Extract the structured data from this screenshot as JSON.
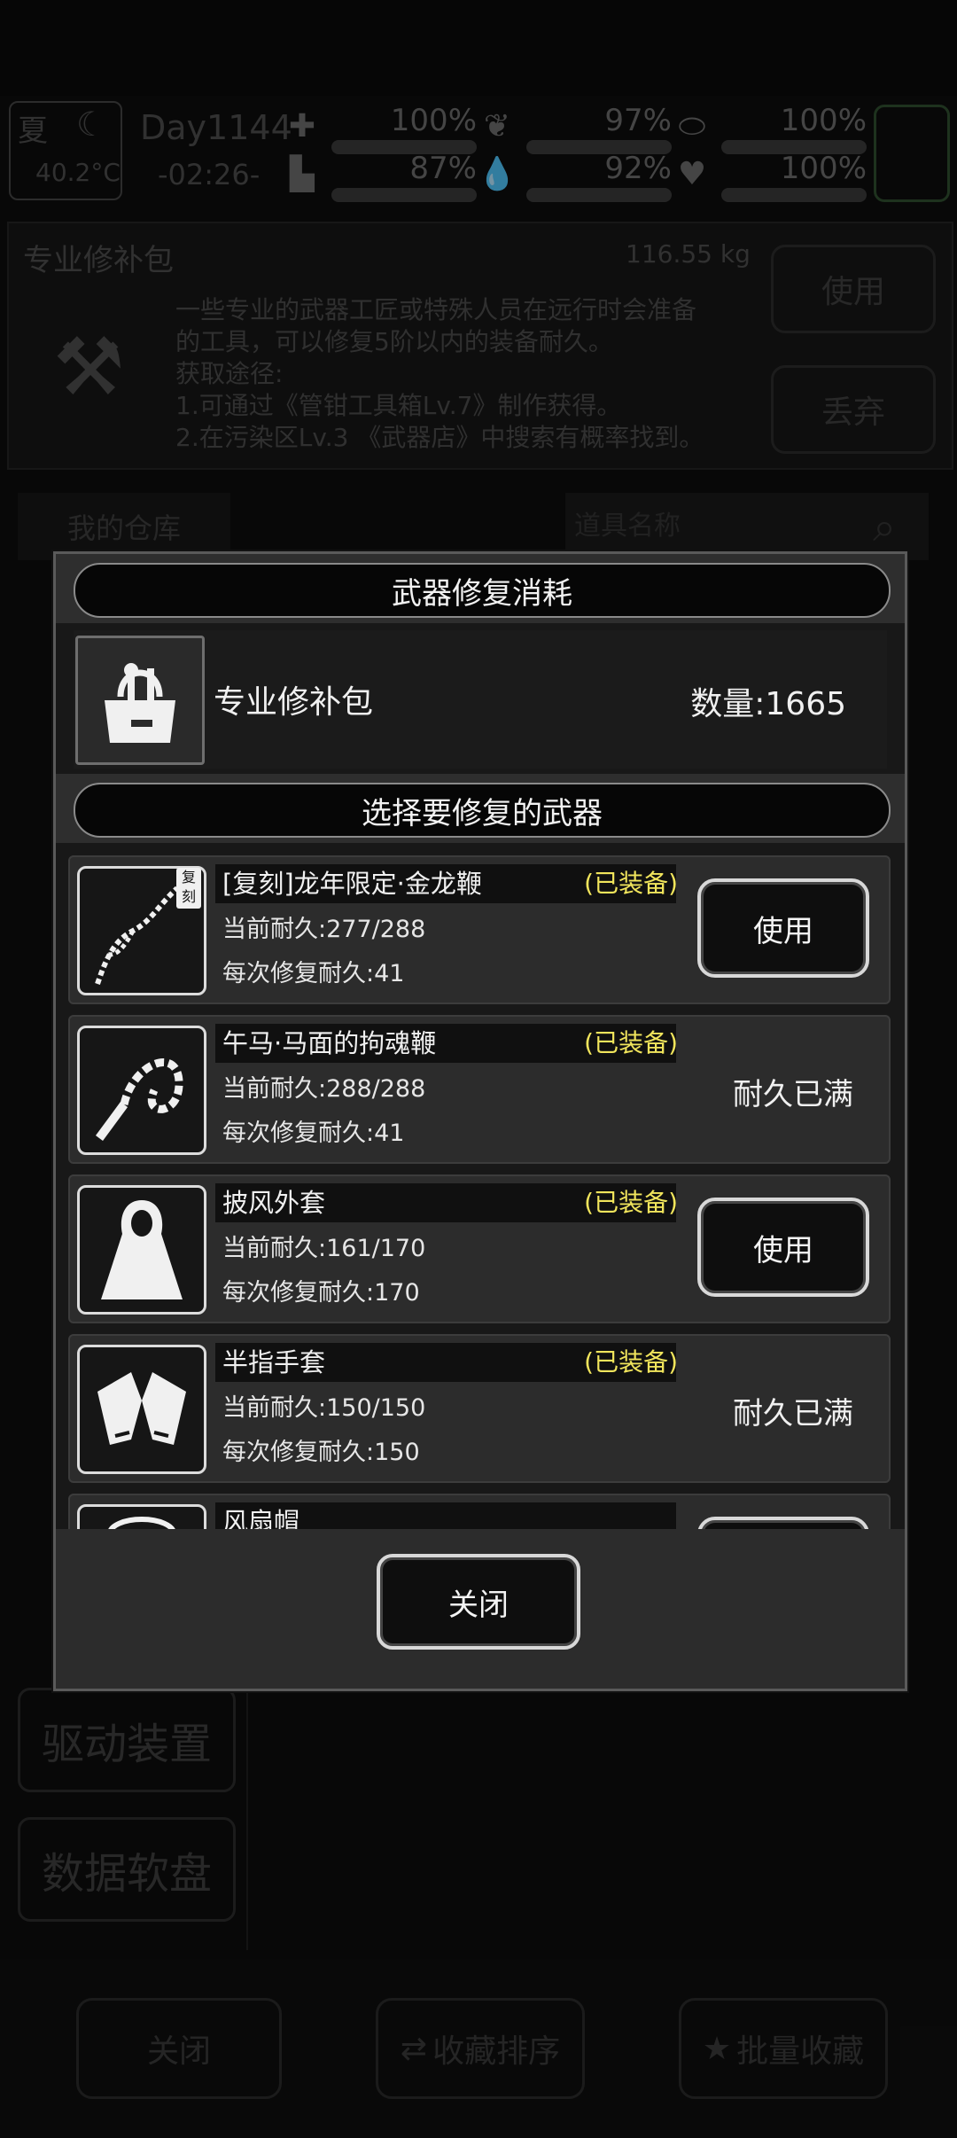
{
  "hud": {
    "season": "夏",
    "temperature": "40.2°C",
    "day": "Day1144",
    "time": "-02:26-",
    "stats": [
      {
        "icon": "medkit-icon",
        "value": "100%",
        "level": 1.0
      },
      {
        "icon": "stomach-icon",
        "value": "97%",
        "level": 0.97
      },
      {
        "icon": "pill-icon",
        "value": "100%",
        "level": 1.0
      },
      {
        "icon": "boot-icon",
        "value": "87%",
        "level": 0.87
      },
      {
        "icon": "water-drop-icon",
        "value": "92%",
        "level": 0.92
      },
      {
        "icon": "heart-icon",
        "value": "100%",
        "level": 1.0
      }
    ]
  },
  "item_panel": {
    "name": "专业修补包",
    "weight": "116.55 kg",
    "description": [
      "一些专业的武器工匠或特殊人员在远行时会准备",
      "的工具，可以修复5阶以内的装备耐久。",
      "获取途径:",
      "1.可通过《管钳工具箱Lv.7》制作获得。",
      "2.在污染区Lv.3 《武器店》中搜索有概率找到。"
    ],
    "use_label": "使用",
    "discard_label": "丢弃"
  },
  "warehouse": {
    "tab_label": "我的仓库",
    "search_placeholder": "道具名称"
  },
  "sidebar": {
    "items": [
      "驱动装置",
      "数据软盘"
    ]
  },
  "bottom_bar": {
    "close_label": "关闭",
    "sort_label": "收藏排序",
    "batch_label": "批量收藏"
  },
  "modal": {
    "title": "武器修复消耗",
    "kit_name": "专业修补包",
    "kit_quantity": "数量:1665",
    "select_title": "选择要修复的武器",
    "weapons": [
      {
        "name": "[复刻]龙年限定·金龙鞭",
        "equipped": "(已装备)",
        "durability": "当前耐久:277/288",
        "repair": "每次修复耐久:41",
        "action": "使用",
        "icon": "whip-icon",
        "badge": "复刻"
      },
      {
        "name": "午马·马面的拘魂鞭",
        "equipped": "(已装备)",
        "durability": "当前耐久:288/288",
        "repair": "每次修复耐久:41",
        "action": "耐久已满",
        "icon": "chain-whip-icon"
      },
      {
        "name": "披风外套",
        "equipped": "(已装备)",
        "durability": "当前耐久:161/170",
        "repair": "每次修复耐久:170",
        "action": "使用",
        "icon": "cloak-icon"
      },
      {
        "name": "半指手套",
        "equipped": "(已装备)",
        "durability": "当前耐久:150/150",
        "repair": "每次修复耐久:150",
        "action": "耐久已满",
        "icon": "gloves-icon"
      },
      {
        "name": "风扇帽",
        "icon": "hat-icon"
      }
    ],
    "close_label": "关闭"
  }
}
